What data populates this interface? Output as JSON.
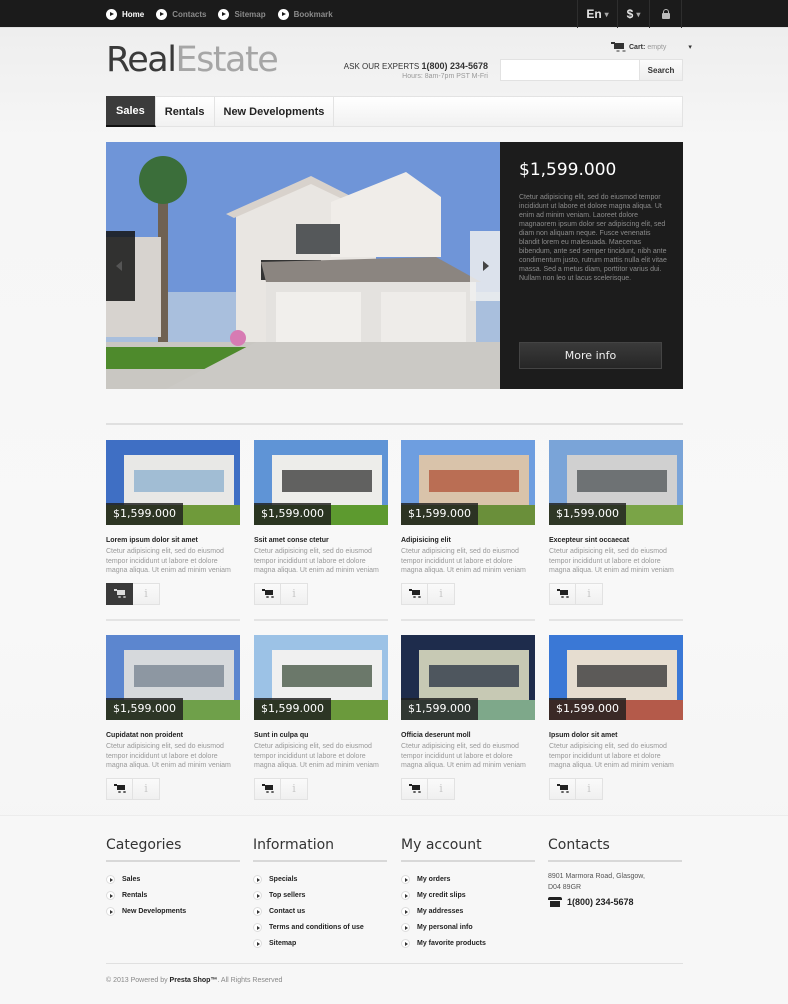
{
  "topbar": {
    "nav": [
      {
        "label": "Home",
        "active": true
      },
      {
        "label": "Contacts",
        "active": false
      },
      {
        "label": "Sitemap",
        "active": false
      },
      {
        "label": "Bookmark",
        "active": false
      }
    ],
    "language": "En",
    "currency": "$",
    "lock_icon": "lock-icon"
  },
  "header": {
    "logo_part1": "Real",
    "logo_part2": "Estate",
    "cart_label": "Cart:",
    "cart_status": "empty",
    "experts_label": "ASK OUR EXPERTS",
    "experts_phone": "1(800) 234-5678",
    "hours": "Hours: 8am-7pm PST M-Fri",
    "search_placeholder": "",
    "search_value": "",
    "search_button": "Search"
  },
  "menu": [
    {
      "label": "Sales",
      "active": true
    },
    {
      "label": "Rentals",
      "active": false
    },
    {
      "label": "New Developments",
      "active": false
    }
  ],
  "slider": {
    "price": "$1,599.000",
    "description": "Ctetur adipisicing elit, sed do eiusmod tempor incididunt ut labore et dolore magna aliqua. Ut enim ad minim veniam. Laoreet dolore magnaorem ipsum dolor ser adipiscing elit, sed diam non aliquam neque. Fusce venenatis blandit lorem eu malesuada. Maecenas bibendum, ante sed semper tincidunt, nibh ante condimentum justo, rutrum mattis nulla elit vitae massa. Sed a metus diam, porttitor varius dui. Nullam non leo ut lacus scelerisque.",
    "button": "More info"
  },
  "products": [
    {
      "price": "$1,599.000",
      "title": "Lorem ipsum dolor sit amet",
      "desc": "Ctetur adipisicing elit, sed do eiusmod tempor incididunt ut labore et dolore magna aliqua. Ut enim ad minim veniam",
      "cart_active": true
    },
    {
      "price": "$1,599.000",
      "title": "Ssit amet conse ctetur",
      "desc": "Ctetur adipisicing elit, sed do eiusmod tempor incididunt ut labore et dolore magna aliqua. Ut enim ad minim veniam",
      "cart_active": false
    },
    {
      "price": "$1,599.000",
      "title": "Adipisicing elit",
      "desc": "Ctetur adipisicing elit, sed do eiusmod tempor incididunt ut labore et dolore magna aliqua. Ut enim ad minim veniam",
      "cart_active": false
    },
    {
      "price": "$1,599.000",
      "title": "Excepteur sint occaecat",
      "desc": "Ctetur adipisicing elit, sed do eiusmod tempor incididunt ut labore et dolore magna aliqua. Ut enim ad minim veniam",
      "cart_active": false
    },
    {
      "price": "$1,599.000",
      "title": "Cupidatat non proident",
      "desc": "Ctetur adipisicing elit, sed do eiusmod tempor incididunt ut labore et dolore magna aliqua. Ut enim ad minim veniam",
      "cart_active": false
    },
    {
      "price": "$1,599.000",
      "title": "Sunt in culpa qu",
      "desc": "Ctetur adipisicing elit, sed do eiusmod tempor incididunt ut labore et dolore magna aliqua. Ut enim ad minim veniam",
      "cart_active": false
    },
    {
      "price": "$1,599.000",
      "title": "Officia deserunt moll",
      "desc": "Ctetur adipisicing elit, sed do eiusmod tempor incididunt ut labore et dolore magna aliqua. Ut enim ad minim veniam",
      "cart_active": false
    },
    {
      "price": "$1,599.000",
      "title": "Ipsum dolor sit amet",
      "desc": "Ctetur adipisicing elit, sed do eiusmod tempor incididunt ut labore et dolore magna aliqua. Ut enim ad minim veniam",
      "cart_active": false
    }
  ],
  "product_info_glyph": "i",
  "footer": {
    "categories": {
      "title": "Categories",
      "items": [
        "Sales",
        "Rentals",
        "New Developments"
      ]
    },
    "information": {
      "title": "Information",
      "items": [
        "Specials",
        "Top sellers",
        "Contact us",
        "Terms and conditions of use",
        "Sitemap"
      ]
    },
    "account": {
      "title": "My account",
      "items": [
        "My orders",
        "My credit slips",
        "My addresses",
        "My personal info",
        "My favorite products"
      ]
    },
    "contacts": {
      "title": "Contacts",
      "address_line1": "8901 Marmora Road, Glasgow,",
      "address_line2": "D04 89GR",
      "phone": "1(800) 234-5678"
    },
    "copyright_pre": "© 2013 Powered by",
    "copyright_brand": "Presta Shop™",
    "copyright_post": ". All Rights Reserved"
  }
}
